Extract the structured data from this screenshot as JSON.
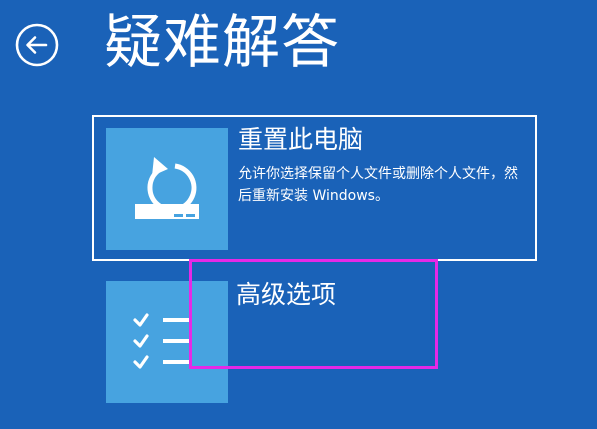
{
  "header": {
    "back_icon": "back-arrow-icon",
    "title": "疑难解答"
  },
  "options": {
    "reset": {
      "title": "重置此电脑",
      "description": "允许你选择保留个人文件或删除个人文件，然后重新安装 Windows。",
      "icon": "reset-pc-icon",
      "selected": true
    },
    "advanced": {
      "title": "高级选项",
      "icon": "checklist-icon",
      "selected": false
    }
  },
  "annotation": {
    "color": "#e629e6"
  },
  "colors": {
    "background": "#1a62b8",
    "tile": "#47a3e0",
    "text": "#ffffff"
  }
}
